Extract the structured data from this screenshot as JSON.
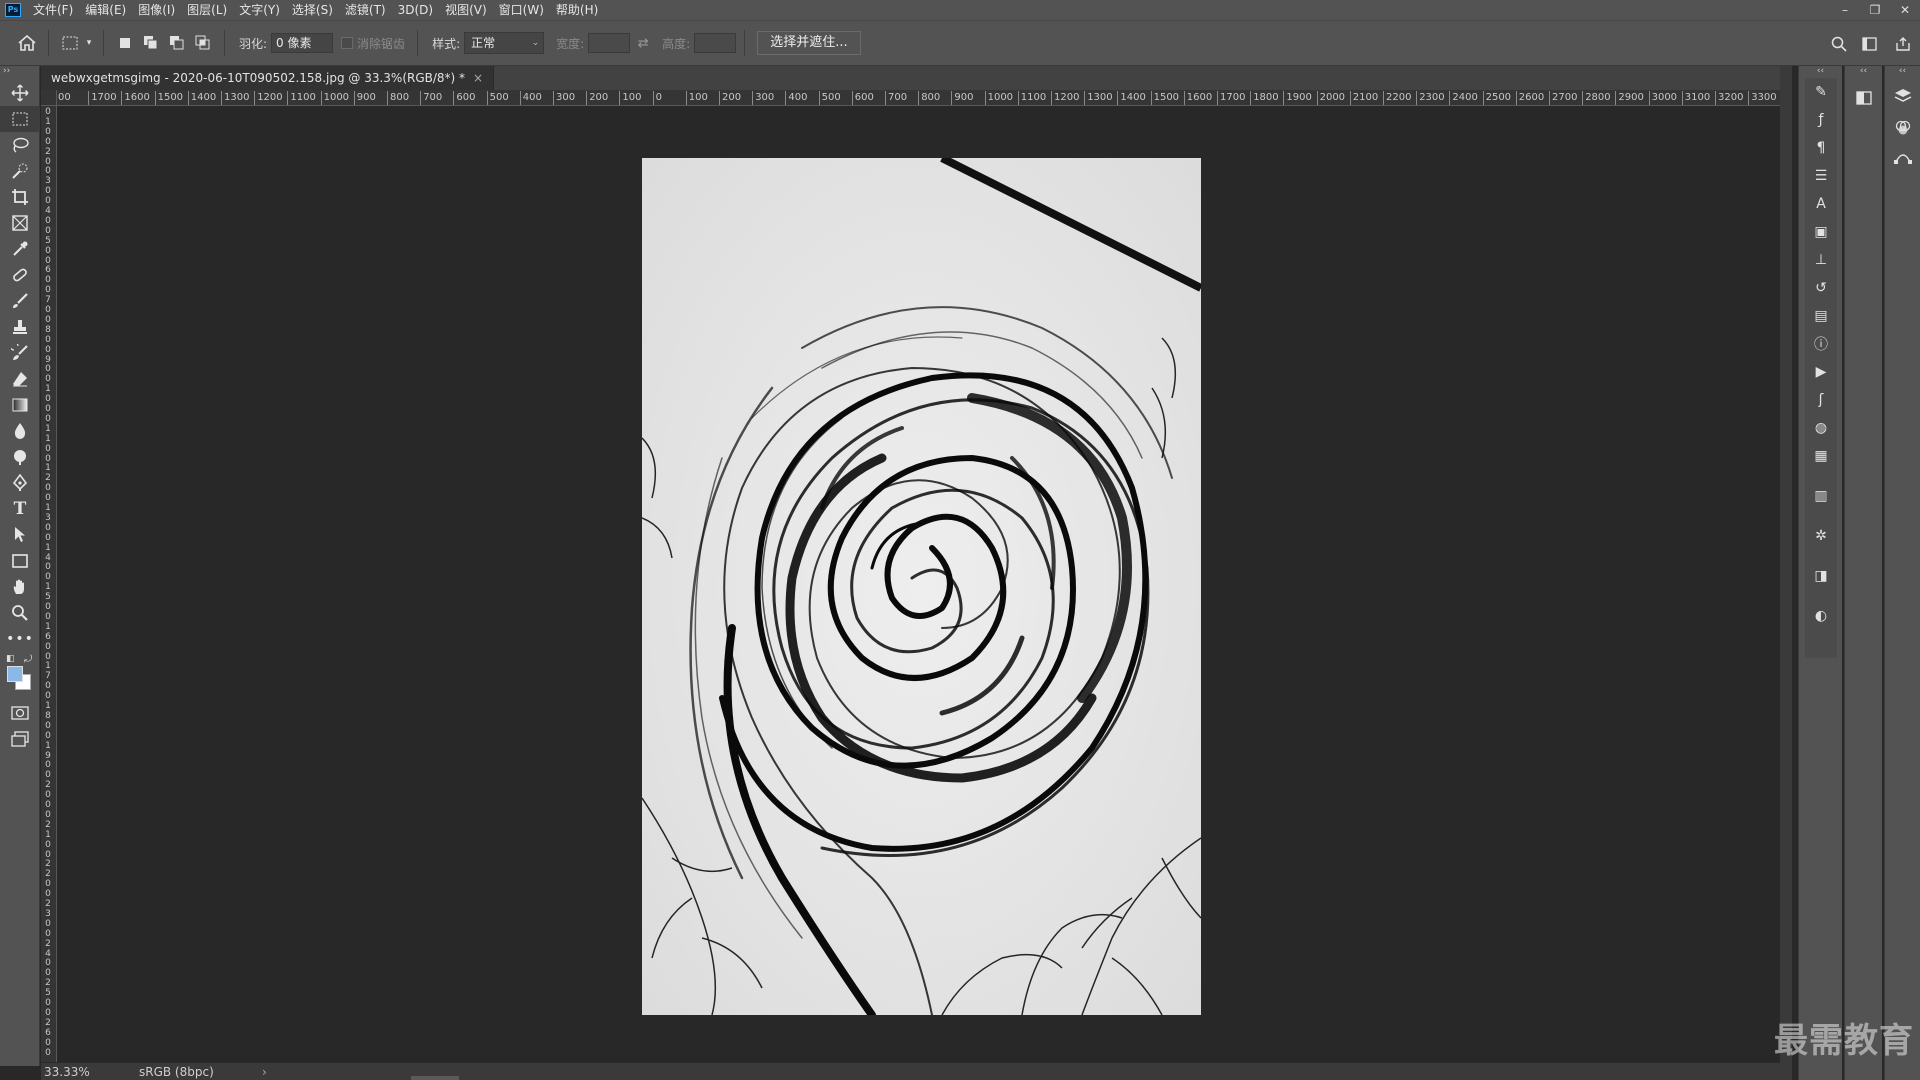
{
  "app": {
    "logo_text": "Ps",
    "window_controls": {
      "minimize": "–",
      "restore": "❐",
      "close": "✕"
    }
  },
  "menu": [
    "文件(F)",
    "编辑(E)",
    "图像(I)",
    "图层(L)",
    "文字(Y)",
    "选择(S)",
    "滤镜(T)",
    "3D(D)",
    "视图(V)",
    "窗口(W)",
    "帮助(H)"
  ],
  "options": {
    "feather_label": "羽化:",
    "feather_value": "0 像素",
    "antialias_label": "消除锯齿",
    "style_label": "样式:",
    "style_value": "正常",
    "width_label": "宽度:",
    "height_label": "高度:",
    "select_mask_button": "选择并遮住..."
  },
  "document": {
    "tab_title": "webwxgetmsgimg - 2020-06-10T090502.158.jpg @ 33.3%(RGB/8*) *",
    "tab_close": "×"
  },
  "ruler": {
    "h_labels": [
      "00",
      "1700",
      "1600",
      "1500",
      "1400",
      "1300",
      "1200",
      "1100",
      "1000",
      "900",
      "800",
      "700",
      "600",
      "500",
      "400",
      "300",
      "200",
      "100",
      "0",
      "100",
      "200",
      "300",
      "400",
      "500",
      "600",
      "700",
      "800",
      "900",
      "1000",
      "1100",
      "1200",
      "1300",
      "1400",
      "1500",
      "1600",
      "1700",
      "1800",
      "1900",
      "2000",
      "2100",
      "2200",
      "2300",
      "2400",
      "2500",
      "2600",
      "2700",
      "2800",
      "2900",
      "3000",
      "3100",
      "3200",
      "3300"
    ],
    "v_labels": [
      "0",
      "1",
      "0",
      "0",
      "2",
      "0",
      "0",
      "3",
      "0",
      "0",
      "4",
      "0",
      "0",
      "5",
      "0",
      "0",
      "6",
      "0",
      "0",
      "7",
      "0",
      "0",
      "8",
      "0",
      "0",
      "9",
      "0",
      "0",
      "1",
      "0",
      "0",
      "0",
      "1",
      "1",
      "0",
      "0",
      "1",
      "2",
      "0",
      "0",
      "1",
      "3",
      "0",
      "0",
      "1",
      "4",
      "0",
      "0",
      "1",
      "5",
      "0",
      "0",
      "1",
      "6",
      "0",
      "0",
      "1",
      "7",
      "0",
      "0",
      "1",
      "8",
      "0",
      "0",
      "1",
      "9",
      "0",
      "0",
      "2",
      "0",
      "0",
      "0",
      "2",
      "1",
      "0",
      "0",
      "2",
      "2",
      "0",
      "0",
      "2",
      "3",
      "0",
      "0",
      "2",
      "4",
      "0",
      "0",
      "2",
      "5",
      "0",
      "0",
      "2",
      "6",
      "0",
      "0"
    ]
  },
  "status": {
    "zoom": "33.33%",
    "color_profile": "sRGB (8bpc)",
    "arrow": "›"
  },
  "watermark": "最需教育",
  "colors": {
    "foreground": "#8ab8e8",
    "background": "#ffffff",
    "canvas_bg": "#282828",
    "panel_bg": "#535353"
  },
  "icons": {
    "home": "home-icon",
    "marquee": "rect-marquee-icon",
    "search": "search-icon",
    "workspace": "workspace-icon",
    "share": "share-icon"
  }
}
